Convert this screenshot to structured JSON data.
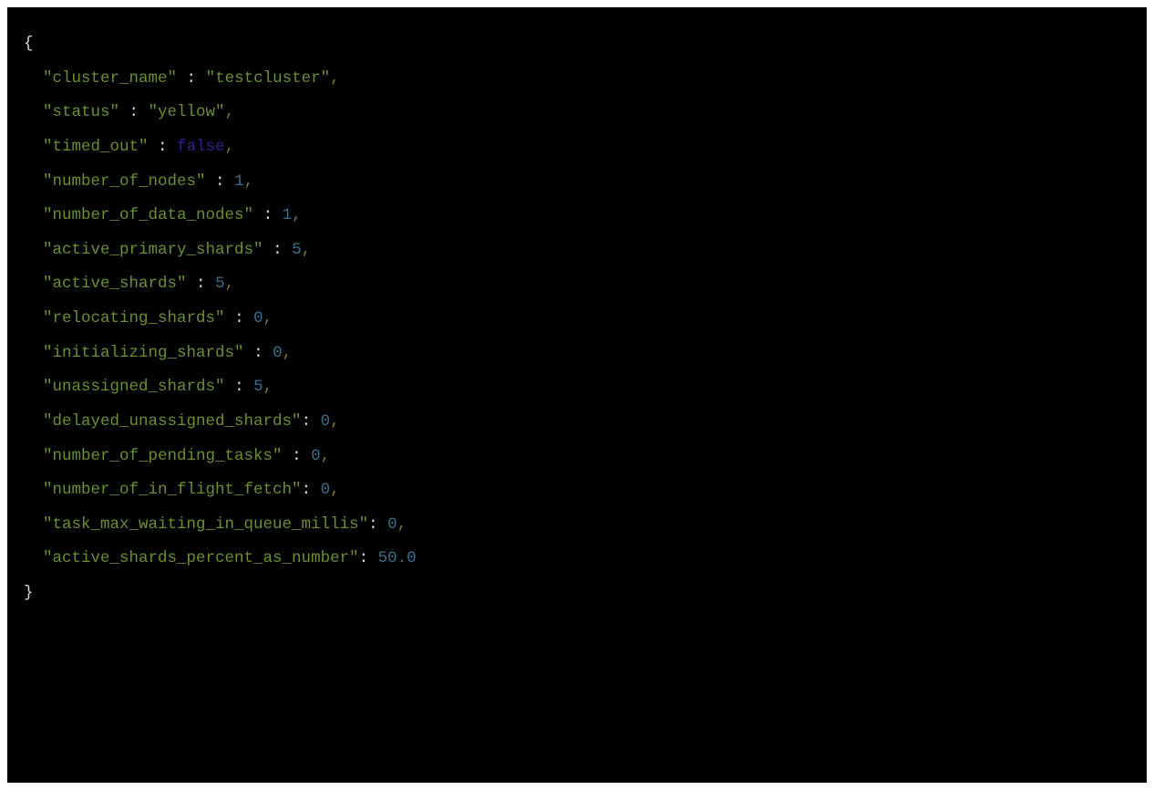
{
  "json_output": {
    "entries": [
      {
        "key": "cluster_name",
        "sep": " : ",
        "value": "testcluster",
        "type": "string",
        "trailing_comma": true
      },
      {
        "key": "status",
        "sep": " : ",
        "value": "yellow",
        "type": "string",
        "trailing_comma": true
      },
      {
        "key": "timed_out",
        "sep": " : ",
        "value": "false",
        "type": "bool",
        "trailing_comma": true
      },
      {
        "key": "number_of_nodes",
        "sep": " : ",
        "value": "1",
        "type": "number",
        "trailing_comma": true
      },
      {
        "key": "number_of_data_nodes",
        "sep": " : ",
        "value": "1",
        "type": "number",
        "trailing_comma": true
      },
      {
        "key": "active_primary_shards",
        "sep": " : ",
        "value": "5",
        "type": "number",
        "trailing_comma": true
      },
      {
        "key": "active_shards",
        "sep": " : ",
        "value": "5",
        "type": "number",
        "trailing_comma": true
      },
      {
        "key": "relocating_shards",
        "sep": " : ",
        "value": "0",
        "type": "number",
        "trailing_comma": true
      },
      {
        "key": "initializing_shards",
        "sep": " : ",
        "value": "0",
        "type": "number",
        "trailing_comma": true
      },
      {
        "key": "unassigned_shards",
        "sep": " : ",
        "value": "5",
        "type": "number",
        "trailing_comma": true
      },
      {
        "key": "delayed_unassigned_shards",
        "sep": ": ",
        "value": "0",
        "type": "number",
        "trailing_comma": true
      },
      {
        "key": "number_of_pending_tasks",
        "sep": " : ",
        "value": "0",
        "type": "number",
        "trailing_comma": true
      },
      {
        "key": "number_of_in_flight_fetch",
        "sep": ": ",
        "value": "0",
        "type": "number",
        "trailing_comma": true
      },
      {
        "key": "task_max_waiting_in_queue_millis",
        "sep": ": ",
        "value": "0",
        "type": "number",
        "trailing_comma": true
      },
      {
        "key": "active_shards_percent_as_number",
        "sep": ": ",
        "value": "50.0",
        "type": "number",
        "trailing_comma": false
      }
    ],
    "open_brace": "{",
    "close_brace": "}"
  }
}
